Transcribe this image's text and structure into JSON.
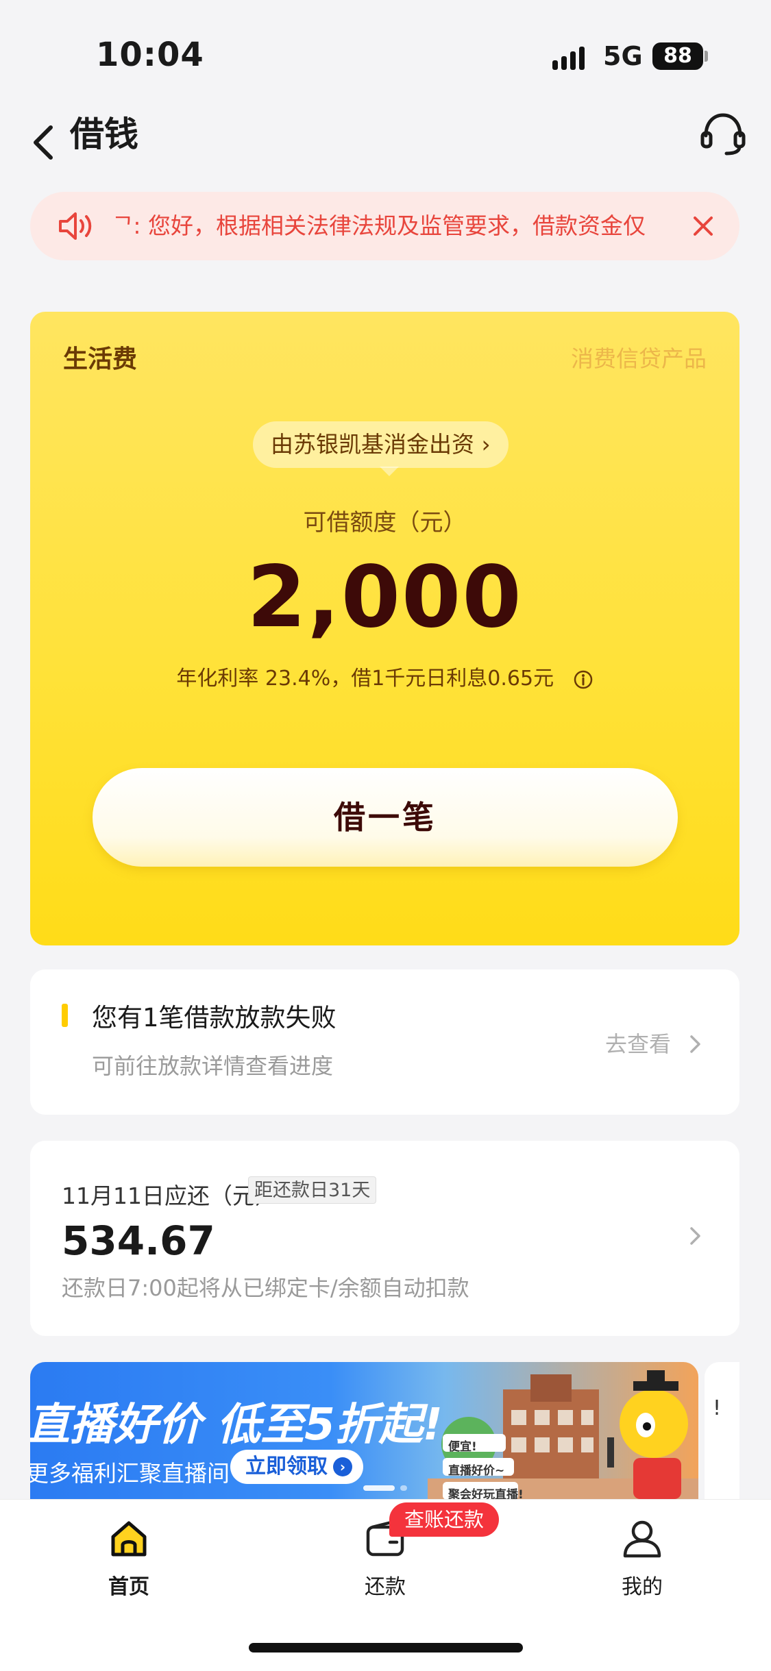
{
  "status_bar": {
    "time": "10:04",
    "network": "5G",
    "battery": "88"
  },
  "nav": {
    "title": "借钱"
  },
  "notice": {
    "text": "ᄀ:  您好，根据相关法律法规及监管要求，借款资金仅"
  },
  "loan_card": {
    "label": "生活费",
    "product": "消费信贷产品",
    "lender": "由苏银凯基消金出资",
    "lender_arrow": "›",
    "limit_label": "可借额度（元）",
    "amount": "2,000",
    "rate_text": "年化利率 23.4%，借1千元日利息0.65元",
    "borrow_button": "借一笔"
  },
  "failure_card": {
    "title": "您有1笔借款放款失败",
    "subtitle": "可前往放款详情查看进度",
    "link": "去查看"
  },
  "repay_card": {
    "due_label": "11月11日应还（元）",
    "days_badge": "距还款日31天",
    "amount": "534.67",
    "note": "还款日7:00起将从已绑定卡/余额自动扣款"
  },
  "banner": {
    "headline": "直播好价 低至5折起!",
    "subline": "更多福利汇聚直播间",
    "claim_button": "立即领取",
    "tags": [
      "便宜!",
      "直播好价~",
      "聚会好玩直播!"
    ],
    "next_peek": "!"
  },
  "tabbar": {
    "items": [
      {
        "label": "首页",
        "icon": "home-icon"
      },
      {
        "label": "还款",
        "icon": "wallet-icon"
      },
      {
        "label": "我的",
        "icon": "profile-icon"
      }
    ],
    "badge": "查账还款"
  },
  "colors": {
    "accent_yellow": "#ffe23a",
    "alert_red": "#e8453c",
    "badge_red": "#f4333c",
    "deep_brown": "#3d0a08"
  }
}
